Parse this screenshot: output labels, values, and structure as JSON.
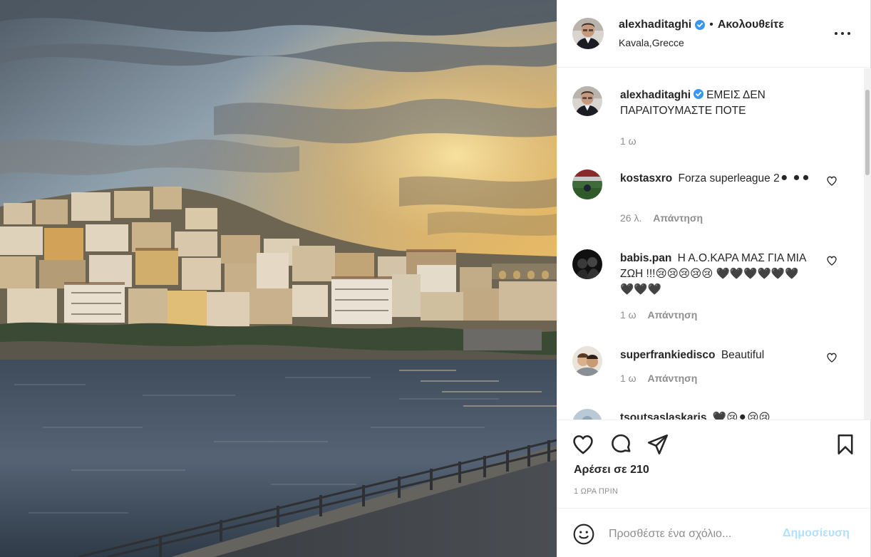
{
  "colors": {
    "accent": "#0095f6",
    "verified": "#3897f0",
    "muted_text": "#8e8e8e",
    "post_disabled": "#b2dffc"
  },
  "header": {
    "username": "alexhaditaghi",
    "separator": "•",
    "follow_state": "Ακολουθείτε",
    "location": "Kavala,Grecce",
    "icons": {
      "verified": "verified-badge-icon",
      "more": "more-options-icon"
    }
  },
  "caption": {
    "username": "alexhaditaghi",
    "text": "ΕΜΕΙΣ ΔΕΝ ΠΑΡΑΙΤΟΥΜΑΣΤΕ ΠΟΤΕ",
    "time": "1 ω"
  },
  "comments": [
    {
      "username": "kostasxro",
      "text": "Forza superleague 2⚫ ⚫⚫",
      "time": "26 λ.",
      "reply": "Απάντηση"
    },
    {
      "username": "babis.pan",
      "text": "Η Α.Ο.ΚΑΡΑ ΜΑΣ ΓΙΑ ΜΙΑ ΖΩΗ !!!😢😢😢😢😢 🖤🖤🖤🖤🖤🖤🖤🖤🖤",
      "time": "1 ω",
      "reply": "Απάντηση"
    },
    {
      "username": "superfrankiedisco",
      "text": "Beautiful",
      "time": "1 ω",
      "reply": "Απάντηση"
    },
    {
      "username": "tsoutsaslaskaris",
      "text": "🖤😢⚫😢😢",
      "time": "",
      "reply": ""
    }
  ],
  "actions": {
    "likes": "Αρέσει σε 210",
    "time_ago": "1 ΩΡΑ ΠΡΙΝ",
    "icons": [
      "like-icon",
      "comment-icon",
      "share-icon",
      "save-icon"
    ]
  },
  "add_comment": {
    "placeholder": "Προσθέστε ένα σχόλιο...",
    "post_label": "Δημοσίευση",
    "icons": {
      "emoji": "emoji-icon"
    }
  }
}
